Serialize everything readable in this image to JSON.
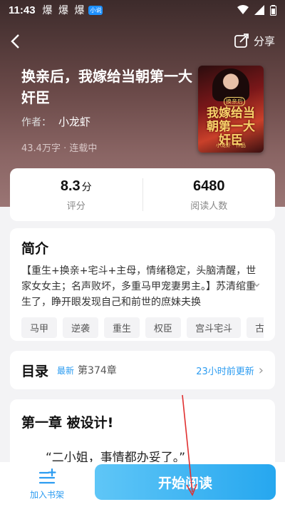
{
  "status": {
    "time": "11:43",
    "notifications": "爆 爆 爆",
    "app_badge": "小说"
  },
  "nav": {
    "share_label": "分享"
  },
  "book": {
    "title": "换亲后，我嫁给当朝第一大奸臣",
    "author_label": "作者：",
    "author": "小龙虾",
    "meta": "43.4万字 · 连载中",
    "cover_text": "我嫁给当朝第一大奸臣",
    "cover_tag": "换亲后",
    "cover_author": "小龙虾 · 作品"
  },
  "stats": {
    "score": "8.3",
    "score_unit": "分",
    "score_label": "评分",
    "readers": "6480",
    "readers_label": "阅读人数"
  },
  "intro": {
    "heading": "简介",
    "text": "【重生+换亲+宅斗+主母，情绪稳定，头脑清醒，世家女女主；名声败坏，多重马甲宠妻男主。】苏清绾重生了，睁开眼发现自己和前世的庶妹夫换",
    "tags": [
      "马甲",
      "逆袭",
      "重生",
      "权臣",
      "宫斗宅斗",
      "古代言情"
    ]
  },
  "toc": {
    "heading": "目录",
    "new_label": "最新",
    "chapter": "第374章",
    "updated": "23小时前更新"
  },
  "chapter": {
    "title": "第一章  被设计!",
    "first_line": "“二小姐，事情都办妥了。”"
  },
  "bottom": {
    "shelf_label": "加入书架",
    "read_label": "开始阅读"
  },
  "colors": {
    "accent": "#2c9cf1",
    "hero": "#6b4a49",
    "annotation": "#e03030"
  }
}
